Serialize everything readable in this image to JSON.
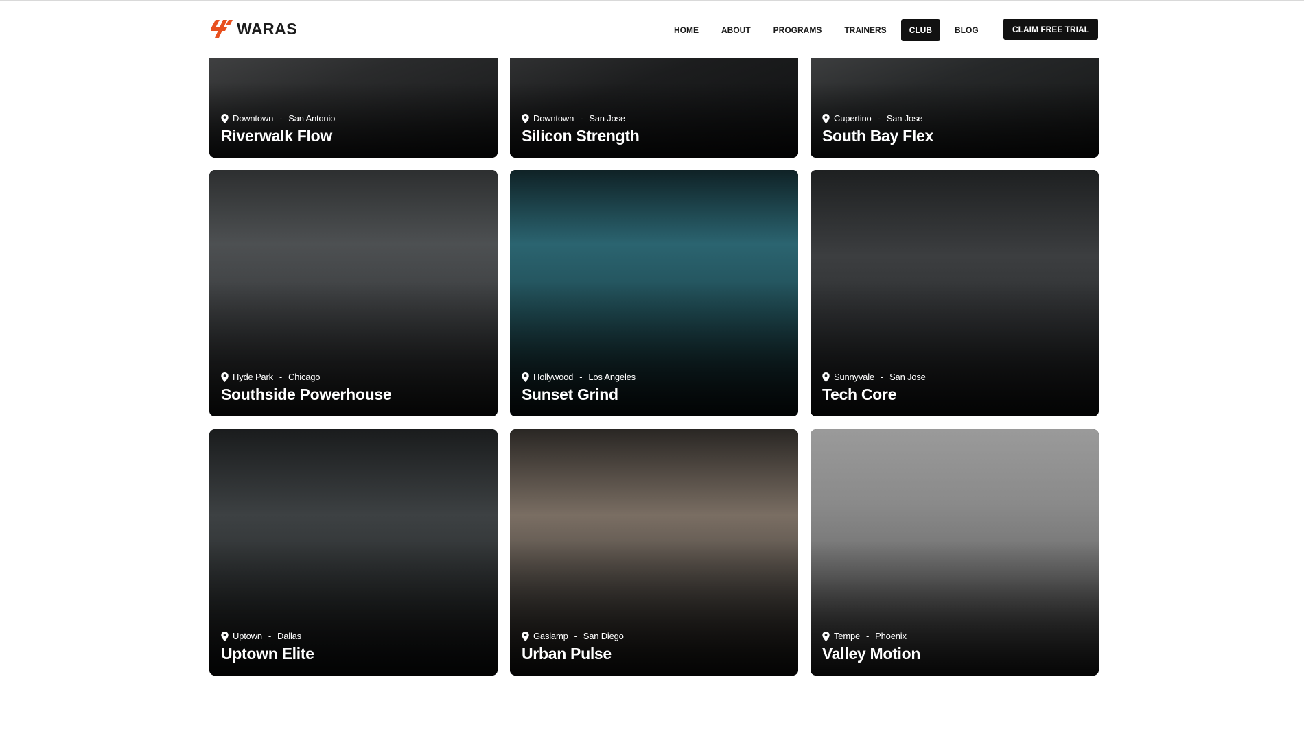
{
  "brand": {
    "name": "WARAS",
    "accent": "#e8501f"
  },
  "nav": {
    "items": [
      {
        "label": "HOME",
        "active": false
      },
      {
        "label": "ABOUT",
        "active": false
      },
      {
        "label": "PROGRAMS",
        "active": false
      },
      {
        "label": "TRAINERS",
        "active": false
      },
      {
        "label": "CLUB",
        "active": true
      },
      {
        "label": "BLOG",
        "active": false
      }
    ],
    "cta_label": "CLAIM FREE TRIAL"
  },
  "clubs": [
    {
      "area": "Downtown",
      "city": "San Antonio",
      "name": "Riverwalk Flow",
      "tone": "#2a2b2c"
    },
    {
      "area": "Downtown",
      "city": "San Jose",
      "name": "Silicon Strength",
      "tone": "#1c1d1e"
    },
    {
      "area": "Cupertino",
      "city": "San Jose",
      "name": "South Bay Flex",
      "tone": "#262829"
    },
    {
      "area": "Hyde Park",
      "city": "Chicago",
      "name": "Southside Powerhouse",
      "tone": "#3a3c3e"
    },
    {
      "area": "Hollywood",
      "city": "Los Angeles",
      "name": "Sunset Grind",
      "tone": "#1f4a52"
    },
    {
      "area": "Sunnyvale",
      "city": "San Jose",
      "name": "Tech Core",
      "tone": "#2c2e30"
    },
    {
      "area": "Uptown",
      "city": "Dallas",
      "name": "Uptown Elite",
      "tone": "#2a2d2e"
    },
    {
      "area": "Gaslamp",
      "city": "San Diego",
      "name": "Urban Pulse",
      "tone": "#4a4540"
    },
    {
      "area": "Tempe",
      "city": "Phoenix",
      "name": "Valley Motion",
      "tone": "#6e6e6e"
    }
  ],
  "separator": "-"
}
